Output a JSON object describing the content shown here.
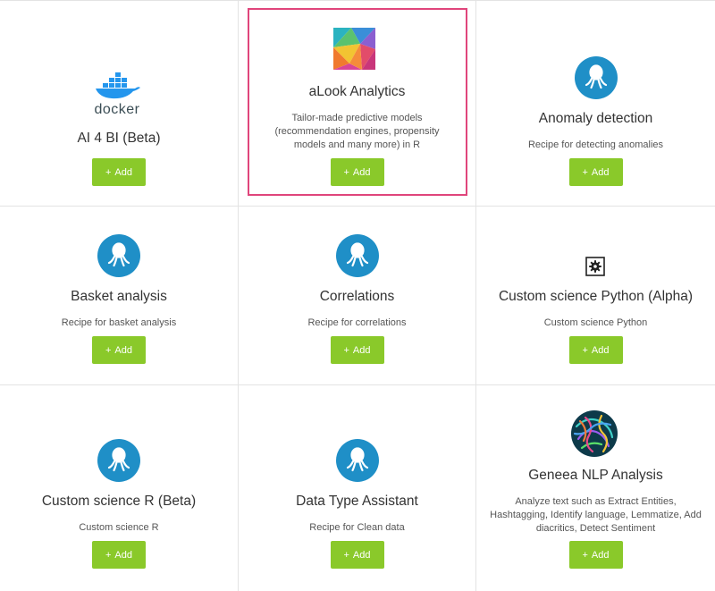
{
  "cards": [
    {
      "title": "AI 4 BI (Beta)",
      "desc": "",
      "logo_text": "docker",
      "add_label": "Add",
      "icon": "docker-icon"
    },
    {
      "title": "aLook Analytics",
      "desc": "Tailor-made predictive models (recommendation engines, propensity models and many more) in R",
      "add_label": "Add",
      "icon": "alook-logo-icon"
    },
    {
      "title": "Anomaly detection",
      "desc": "Recipe for detecting anomalies",
      "add_label": "Add",
      "icon": "octopus-icon"
    },
    {
      "title": "Basket analysis",
      "desc": "Recipe for basket analysis",
      "add_label": "Add",
      "icon": "octopus-icon"
    },
    {
      "title": "Correlations",
      "desc": "Recipe for correlations",
      "add_label": "Add",
      "icon": "octopus-icon"
    },
    {
      "title": "Custom science Python (Alpha)",
      "desc": "Custom science Python",
      "add_label": "Add",
      "icon": "gear-icon"
    },
    {
      "title": "Custom science R (Beta)",
      "desc": "Custom science R",
      "add_label": "Add",
      "icon": "octopus-icon"
    },
    {
      "title": "Data Type Assistant",
      "desc": "Recipe for Clean data",
      "add_label": "Add",
      "icon": "octopus-icon"
    },
    {
      "title": "Geneea NLP Analysis",
      "desc": "Analyze text such as Extract Entities, Hashtagging, Identify language, Lemmatize, Add diacritics, Detect Sentiment",
      "add_label": "Add",
      "icon": "geneea-logo-icon"
    }
  ],
  "colors": {
    "add_button": "#8ac92a",
    "octopus_circle": "#1f8fc7",
    "highlight_border": "#e0457b"
  },
  "add_plus": "+"
}
